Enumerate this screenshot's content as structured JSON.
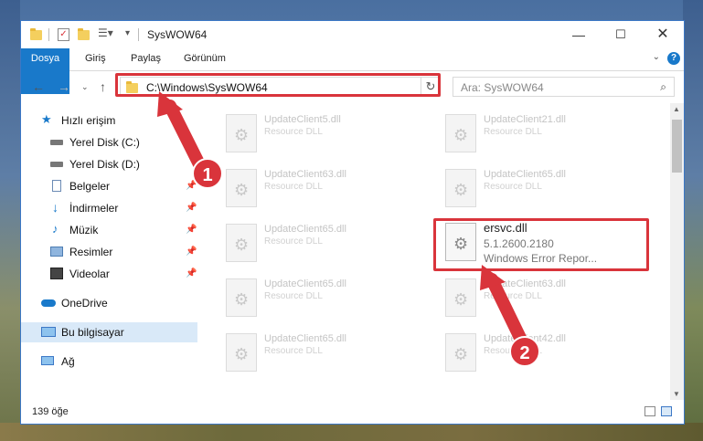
{
  "window": {
    "title": "SysWOW64"
  },
  "ribbon": {
    "tabs": [
      "Dosya",
      "Giriş",
      "Paylaş",
      "Görünüm"
    ]
  },
  "address": {
    "path": "C:\\Windows\\SysWOW64",
    "search_placeholder": "Ara: SysWOW64"
  },
  "sidebar": {
    "items": [
      {
        "label": "Hızlı erişim",
        "icon": "star-icon"
      },
      {
        "label": "Yerel Disk (C:)",
        "icon": "drive-icon",
        "pinned": true
      },
      {
        "label": "Yerel Disk (D:)",
        "icon": "drive-icon",
        "pinned": true
      },
      {
        "label": "Belgeler",
        "icon": "documents-icon",
        "pinned": true
      },
      {
        "label": "İndirmeler",
        "icon": "download-icon",
        "pinned": true
      },
      {
        "label": "Müzik",
        "icon": "music-icon",
        "pinned": true
      },
      {
        "label": "Resimler",
        "icon": "pictures-icon",
        "pinned": true
      },
      {
        "label": "Videolar",
        "icon": "videos-icon",
        "pinned": true
      },
      {
        "label": "OneDrive",
        "icon": "cloud-icon"
      },
      {
        "label": "Bu bilgisayar",
        "icon": "computer-icon",
        "selected": true
      },
      {
        "label": "Ağ",
        "icon": "network-icon"
      }
    ]
  },
  "files": [
    {
      "name": "UpdateClient5.dll",
      "desc": "Resource DLL"
    },
    {
      "name": "UpdateClient21.dll",
      "desc": "Resource DLL"
    },
    {
      "name": "UpdateClient63.dll",
      "desc": "Resource DLL"
    },
    {
      "name": "UpdateClient65.dll",
      "desc": "Resource DLL"
    },
    {
      "name": "UpdateClient65.dll",
      "desc": "Resource DLL"
    },
    {
      "name": "UpdateClient65.dll",
      "desc": "Resource DLL"
    },
    {
      "name": "UpdateClient63.dll",
      "desc": "Resource DLL"
    },
    {
      "name": "UpdateClient65.dll",
      "desc": "Resource DLL"
    },
    {
      "name": "UpdateClient42.dll",
      "desc": "Resource DLL"
    }
  ],
  "highlighted_file": {
    "name": "ersvc.dll",
    "version": "5.1.2600.2180",
    "description": "Windows Error Repor..."
  },
  "status": {
    "count": "139 öğe"
  },
  "callouts": {
    "one": "1",
    "two": "2"
  },
  "colors": {
    "accent": "#1979ca",
    "highlight": "#d9343b"
  }
}
